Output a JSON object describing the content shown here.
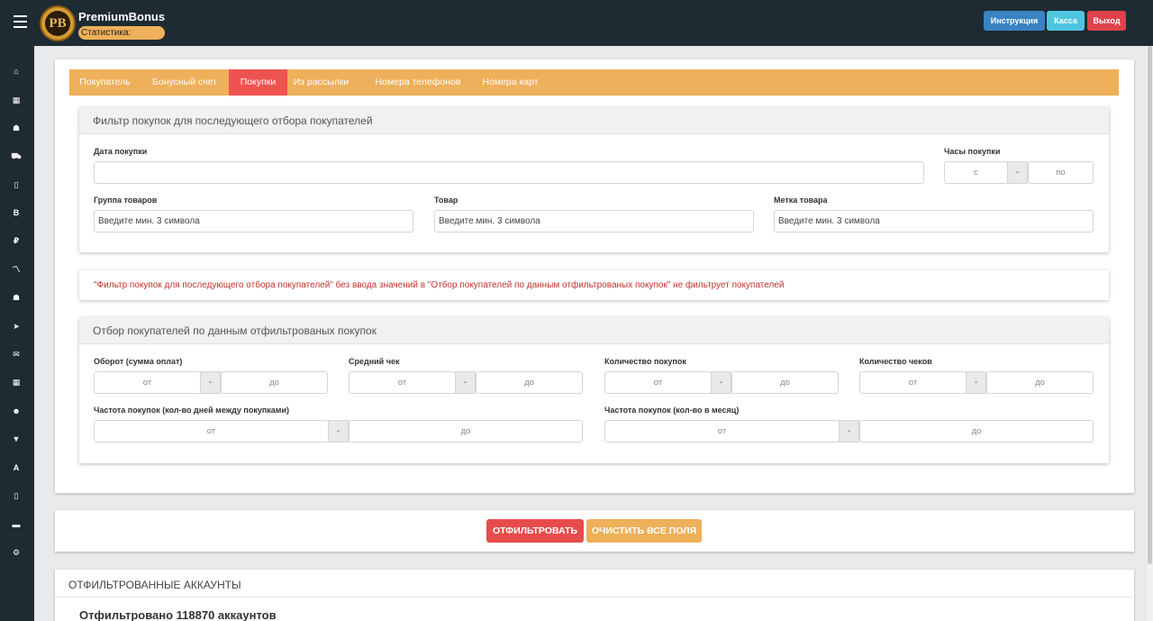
{
  "header": {
    "brand": "PremiumBonus",
    "logo_letters": "PB",
    "statistics_label": "Статистика:",
    "buttons": {
      "instruction": "Инструкция",
      "kassa": "Касса",
      "exit": "Выход"
    }
  },
  "sidebar": {
    "icons": [
      "home-icon",
      "film-icon",
      "users-icon",
      "cart-icon",
      "book-icon",
      "bitcoin-icon",
      "ruble-icon",
      "chart-icon",
      "group-icon",
      "send-icon",
      "mail-icon",
      "film-2-icon",
      "user-group-icon",
      "shirt-icon",
      "road-icon",
      "mobile-icon",
      "card-icon",
      "gear-icon"
    ]
  },
  "tabs": [
    {
      "label": "Покупатель",
      "active": false
    },
    {
      "label": "Бонусный счет",
      "active": false
    },
    {
      "label": "Покупки",
      "active": true
    },
    {
      "label": "Из рассылки",
      "active": false
    },
    {
      "label": "Номера телефонов",
      "active": false
    },
    {
      "label": "Номера карт",
      "active": false
    }
  ],
  "purchase_filter": {
    "title": "Фильтр покупок для последующего отбора покупателей",
    "date_label": "Дата покупки",
    "date_value": "",
    "hours_label": "Часы покупки",
    "hours_from": "с",
    "hours_sep": "-",
    "hours_to": "по",
    "group_label": "Группа товаров",
    "group_placeholder": "Введите мин. 3 символа",
    "product_label": "Товар",
    "product_placeholder": "Введите мин. 3 символа",
    "tag_label": "Метка товара",
    "tag_placeholder": "Введите мин. 3 символа"
  },
  "warning_text": "\"Фильтр покупок для последующего отбора покупателей\" без ввода значений в \"Отбор покупателей по данным отфильтрованых покупок\" не фильтрует покупателей",
  "buyer_selection": {
    "title": "Отбор покупателей по данным отфильтрованых покупок",
    "from": "от",
    "to": "до",
    "sep": "-",
    "turnover_label": "Оборот (сумма оплат)",
    "avg_check_label": "Средний чек",
    "purchases_count_label": "Количество покупок",
    "checks_count_label": "Количество чеков",
    "freq_days_label": "Частота покупок (кол-во дней между покупками)",
    "freq_month_label": "Частота покупок (кол-во в месяц)"
  },
  "actions": {
    "filter": "ОТФИЛЬТРОВАТЬ",
    "clear": "ОЧИСТИТЬ ВСЕ ПОЛЯ"
  },
  "results": {
    "title": "ОТФИЛЬТРОВАННЫЕ АККАУНТЫ",
    "count_text": "Отфильтровано 118870 аккаунтов"
  },
  "colors": {
    "topbar": "#1e2b33",
    "tabs_bg": "#eeb05a",
    "tab_active": "#ef5350",
    "instruction": "#3a83c3",
    "kassa": "#4cc6e0",
    "exit": "#e0424d",
    "warning_text": "#c0322b"
  }
}
